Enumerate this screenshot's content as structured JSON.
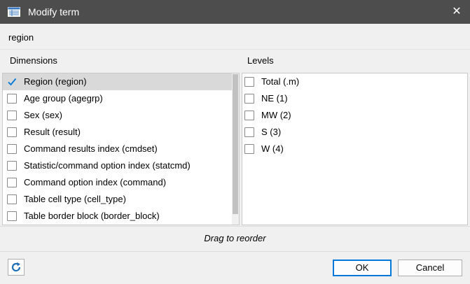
{
  "window": {
    "title": "Modify term",
    "close_glyph": "✕",
    "title_icon": "table-icon"
  },
  "term": {
    "name": "region"
  },
  "dimensions": {
    "header": "Dimensions",
    "items": [
      {
        "label": "Region (region)",
        "checked": true,
        "selected": true
      },
      {
        "label": "Age group (agegrp)",
        "checked": false,
        "selected": false
      },
      {
        "label": "Sex (sex)",
        "checked": false,
        "selected": false
      },
      {
        "label": "Result (result)",
        "checked": false,
        "selected": false
      },
      {
        "label": "Command results index (cmdset)",
        "checked": false,
        "selected": false
      },
      {
        "label": "Statistic/command option index (statcmd)",
        "checked": false,
        "selected": false
      },
      {
        "label": "Command option index (command)",
        "checked": false,
        "selected": false
      },
      {
        "label": "Table cell type (cell_type)",
        "checked": false,
        "selected": false
      },
      {
        "label": "Table border block (border_block)",
        "checked": false,
        "selected": false
      }
    ]
  },
  "levels": {
    "header": "Levels",
    "items": [
      {
        "label": "Total (.m)",
        "checked": false
      },
      {
        "label": "NE (1)",
        "checked": false
      },
      {
        "label": "MW (2)",
        "checked": false
      },
      {
        "label": "S (3)",
        "checked": false
      },
      {
        "label": "W (4)",
        "checked": false
      }
    ]
  },
  "footer": {
    "hint": "Drag to reorder",
    "ok_label": "OK",
    "cancel_label": "Cancel",
    "refresh_icon": "refresh-icon"
  },
  "colors": {
    "titlebar": "#4d4d4d",
    "selection": "#d9d9d9",
    "check": "#0078d7",
    "refresh": "#1e6fb8"
  }
}
